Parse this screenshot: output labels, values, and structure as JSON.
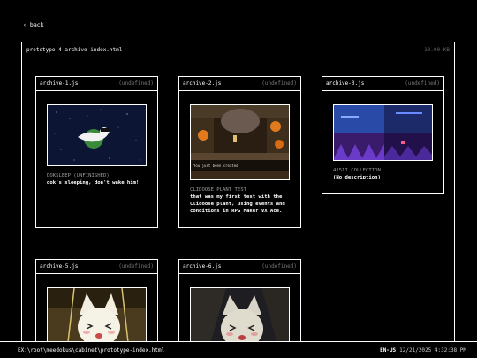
{
  "nav": {
    "back_label": "back",
    "back_icon": "‹"
  },
  "window": {
    "title": "prototype-4-archive-index.html",
    "size": "10.00 KB"
  },
  "cards": [
    {
      "title": "archive-1.js",
      "meta": "(undefined)",
      "caption": "DOKSLEEP (UNFINISHED)",
      "desc": "dok's sleeping, don't wake him!"
    },
    {
      "title": "archive-2.js",
      "meta": "(undefined)",
      "caption": "CLIDOOSE PLANT TEST",
      "desc": "that was my first test with the Clidoose plant, using events and conditions in RPG Maker VX Ace."
    },
    {
      "title": "archive-3.js",
      "meta": "(undefined)",
      "caption": "415II COLLECTION",
      "desc": "(No description)"
    },
    {
      "title": "archive-5.js",
      "meta": "(undefined)"
    },
    {
      "title": "archive-6.js",
      "meta": "(undefined)"
    }
  ],
  "game_text": "You just been created",
  "taskbar": {
    "path": "EX:\\root\\meedokus\\cabinet\\prototype-index.html",
    "lang": "EN-US",
    "datetime": "12/21/2025 4:32:38 PM"
  },
  "colors": {
    "bg": "#000000",
    "fg": "#ffffff",
    "muted": "#9a9a9a",
    "space": "#0d1535",
    "cave": "#3a2a1a"
  }
}
